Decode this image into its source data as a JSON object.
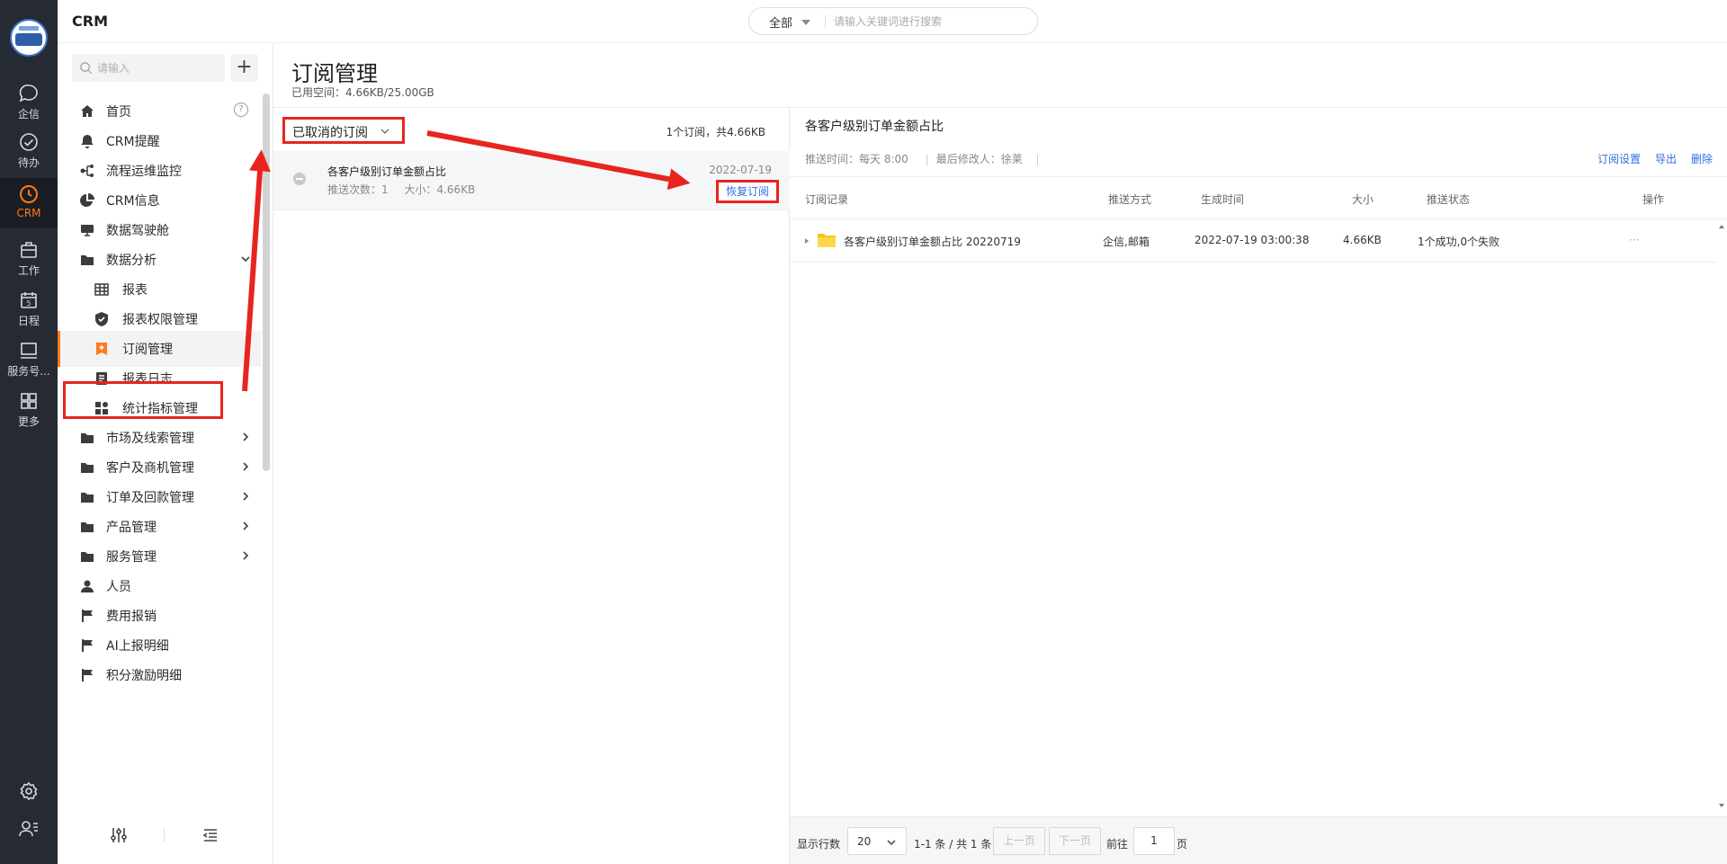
{
  "app": {
    "title": "CRM"
  },
  "rail": {
    "items": [
      {
        "id": "qixin",
        "label": "企信",
        "icon": "chat-bubble-icon"
      },
      {
        "id": "todo",
        "label": "待办",
        "icon": "check-circle-icon"
      },
      {
        "id": "crm",
        "label": "CRM",
        "icon": "clock-icon",
        "active": true
      },
      {
        "id": "work",
        "label": "工作",
        "icon": "briefcase-icon"
      },
      {
        "id": "schedule",
        "label": "日程",
        "icon": "calendar-icon"
      },
      {
        "id": "service",
        "label": "服务号...",
        "icon": "monitor-icon"
      },
      {
        "id": "more",
        "label": "更多",
        "icon": "grid-icon"
      }
    ],
    "bottom_icons": [
      "settings-gear-icon",
      "user-list-icon"
    ]
  },
  "global_search": {
    "scope": "全部",
    "placeholder": "请输入关键词进行搜索"
  },
  "sidebar": {
    "search_placeholder": "请输入",
    "add_label": "+",
    "help_label": "?",
    "items": [
      {
        "label": "首页",
        "icon": "home-icon"
      },
      {
        "label": "CRM提醒",
        "icon": "bell-icon"
      },
      {
        "label": "流程运维监控",
        "icon": "flow-icon"
      },
      {
        "label": "CRM信息",
        "icon": "pie-icon"
      },
      {
        "label": "数据驾驶舱",
        "icon": "dashboard-icon"
      },
      {
        "label": "数据分析",
        "icon": "folder-icon",
        "expanded": true
      },
      {
        "label": "报表",
        "icon": "table-icon",
        "sub": true
      },
      {
        "label": "报表权限管理",
        "icon": "shield-icon",
        "sub": true
      },
      {
        "label": "订阅管理",
        "icon": "bookmark-icon",
        "sub": true,
        "active": true
      },
      {
        "label": "报表日志",
        "icon": "log-icon",
        "sub": true
      },
      {
        "label": "统计指标管理",
        "icon": "metrics-icon",
        "sub": true
      },
      {
        "label": "市场及线索管理",
        "icon": "folder-icon",
        "collapsed": true
      },
      {
        "label": "客户及商机管理",
        "icon": "folder-icon",
        "collapsed": true
      },
      {
        "label": "订单及回款管理",
        "icon": "folder-icon",
        "collapsed": true
      },
      {
        "label": "产品管理",
        "icon": "folder-icon",
        "collapsed": true
      },
      {
        "label": "服务管理",
        "icon": "folder-icon",
        "collapsed": true
      },
      {
        "label": "人员",
        "icon": "person-icon"
      },
      {
        "label": "费用报销",
        "icon": "flag-icon"
      },
      {
        "label": "AI上报明细",
        "icon": "flag-icon"
      },
      {
        "label": "积分激励明细",
        "icon": "flag-icon"
      }
    ]
  },
  "page": {
    "title": "订阅管理",
    "storage": "已用空间：4.66KB/25.00GB"
  },
  "list": {
    "filter_label": "已取消的订阅",
    "summary": "1个订阅，共4.66KB",
    "items": [
      {
        "name": "各客户级别订单金额占比",
        "push_count": "推送次数：1",
        "size": "大小：4.66KB",
        "date": "2022-07-19",
        "action": "恢复订阅"
      }
    ]
  },
  "detail": {
    "title": "各客户级别订单金额占比",
    "push_time": "推送时间：每天 8:00",
    "last_modifier": "最后修改人：徐莱",
    "actions": [
      "订阅设置",
      "导出",
      "删除"
    ],
    "columns": [
      "订阅记录",
      "推送方式",
      "生成时间",
      "大小",
      "推送状态",
      "操作"
    ],
    "rows": [
      {
        "record": "各客户级别订单金额占比 20220719",
        "method": "企信,邮箱",
        "time": "2022-07-19 03:00:38",
        "size": "4.66KB",
        "status": "1个成功,0个失败",
        "op": "···"
      }
    ]
  },
  "pager": {
    "rows_label": "显示行数",
    "page_size": "20",
    "range": "1-1 条 / 共 1 条",
    "prev": "上一页",
    "next": "下一页",
    "goto": "前往",
    "page": "1",
    "page_suffix": "页"
  },
  "colors": {
    "accent": "#ff7a1a",
    "link": "#2f6fe0",
    "annotation": "#e8241f",
    "rail_bg": "#262a33"
  }
}
